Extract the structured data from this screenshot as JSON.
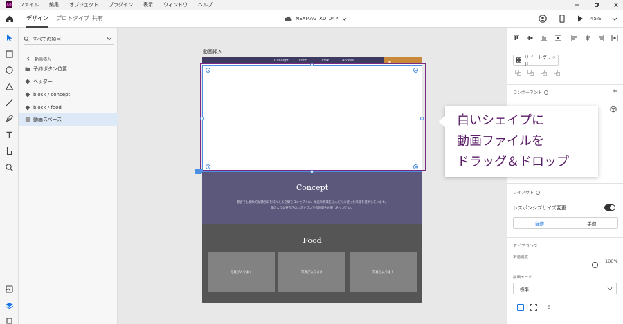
{
  "menubar": {
    "logo_text": "Xd",
    "items": [
      "ファイル",
      "編集",
      "オブジェクト",
      "プラグイン",
      "表示",
      "ウィンドウ",
      "ヘルプ"
    ]
  },
  "toolbar": {
    "tabs": [
      "デザイン",
      "プロトタイプ",
      "共有"
    ],
    "active_tab": "デザイン",
    "document_title": "NEXMAG_XD_04 *",
    "zoom": "45%"
  },
  "layers": {
    "search_placeholder": "すべての項目",
    "back_label": "動画挿入",
    "items": [
      {
        "label": "予約ボタン位置",
        "icon": "folder-icon",
        "selected": false
      },
      {
        "label": "ヘッダー",
        "icon": "component-icon",
        "selected": false
      },
      {
        "label": "block / concept",
        "icon": "component-icon",
        "selected": false
      },
      {
        "label": "block / food",
        "icon": "component-icon",
        "selected": false
      },
      {
        "label": "動画スペース",
        "icon": "rectangle-icon",
        "selected": true
      }
    ]
  },
  "artboard": {
    "name": "動画挿入",
    "nav_links": [
      "Concept",
      "Food",
      "Drink",
      "Access"
    ],
    "concept": {
      "title": "Concept",
      "line1": "都会でも牧歌的な雰囲気を味わえる空間をコンセプトに、地元の野菜をふんだんに使った料理を提供しています。",
      "line2": "森のような安らぎのレストランでの時間をお楽しみください。"
    },
    "food": {
      "title": "Food",
      "photos": [
        "写真が入ります",
        "写真が入ります",
        "写真が入ります"
      ]
    }
  },
  "callout": {
    "lines": [
      "白いシェイプに",
      "動画ファイルを",
      "ドラッグ＆ドロップ"
    ]
  },
  "props": {
    "repeat_grid_label": "リピートグリッド",
    "component_label": "コンポーネント",
    "layout_label": "レイアウト",
    "responsive_resize_label": "レスポンシブサイズ変更",
    "responsive_on": true,
    "seg_auto": "自動",
    "seg_manual": "手動",
    "appearance_label": "アピアランス",
    "opacity_label": "不透明度",
    "opacity_value": "100%",
    "blend_label": "描画モード",
    "blend_value": "標準",
    "fx_value": "0"
  },
  "colors": {
    "accent_blue": "#4d90e3",
    "selection_purple": "#7b2a82",
    "nav": "#3f3a62",
    "concept_bg": "#5b587b",
    "food_bg": "#555555",
    "reserve_btn": "#c88a3a",
    "callout_text": "#5b1d67"
  }
}
